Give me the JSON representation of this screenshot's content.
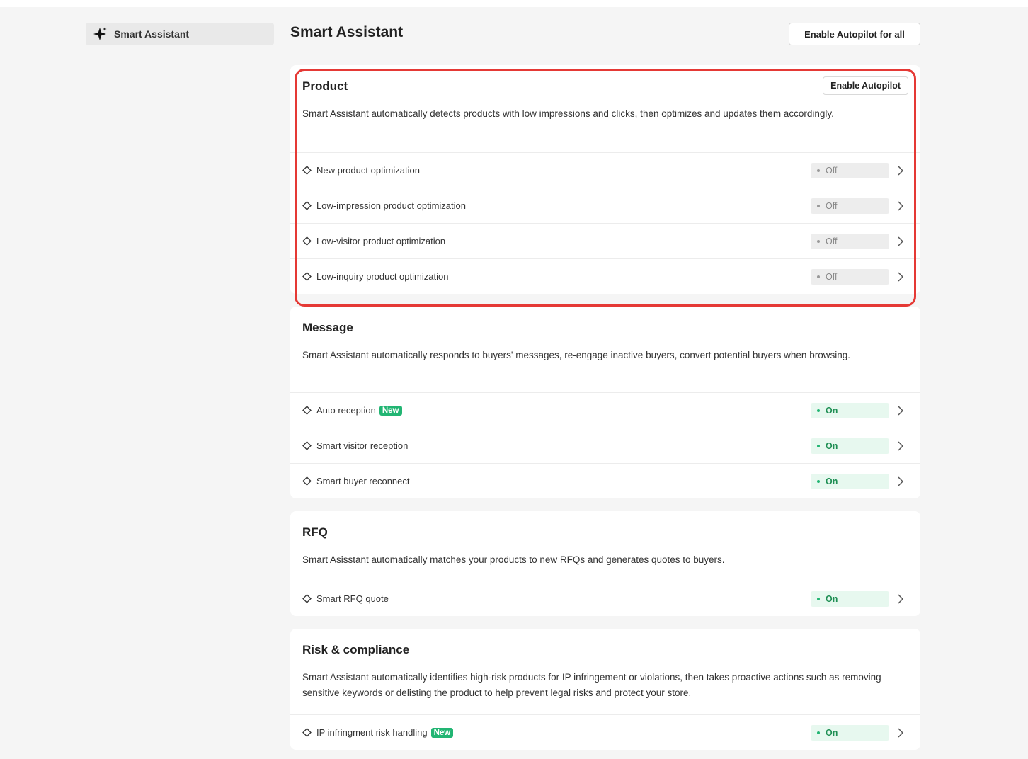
{
  "sidebar": {
    "item_label": "Smart Assistant"
  },
  "header": {
    "title": "Smart Assistant",
    "enable_all_label": "Enable Autopilot for all"
  },
  "colors": {
    "on": "#1f8f54",
    "off": "#888888",
    "new_badge": "#22b573",
    "highlight": "#e53935"
  },
  "sections": [
    {
      "title": "Product",
      "button": "Enable Autopilot",
      "description": "Smart Assistant automatically detects products with low impressions and clicks, then optimizes and updates them accordingly.",
      "items": [
        {
          "label": "New product optimization",
          "status": "Off"
        },
        {
          "label": "Low-impression product optimization",
          "status": "Off"
        },
        {
          "label": "Low-visitor product optimization",
          "status": "Off"
        },
        {
          "label": "Low-inquiry product optimization",
          "status": "Off"
        }
      ]
    },
    {
      "title": "Message",
      "description": "Smart Assistant automatically responds to buyers' messages, re-engage inactive buyers, convert potential buyers when browsing.",
      "items": [
        {
          "label": "Auto reception",
          "badge": "New",
          "status": "On"
        },
        {
          "label": "Smart visitor reception",
          "status": "On"
        },
        {
          "label": "Smart buyer reconnect",
          "status": "On"
        }
      ]
    },
    {
      "title": "RFQ",
      "description": "Smart Asisstant automatically matches your products to new RFQs and generates quotes to buyers.",
      "items": [
        {
          "label": "Smart RFQ quote",
          "status": "On"
        }
      ]
    },
    {
      "title": "Risk & compliance",
      "description": "Smart Assistant automatically identifies high-risk products for IP infringement or violations, then takes proactive actions such as removing sensitive keywords or delisting the product to help prevent legal risks and protect your store.",
      "items": [
        {
          "label": "IP infringment risk handling",
          "badge": "New",
          "status": "On"
        }
      ]
    }
  ]
}
